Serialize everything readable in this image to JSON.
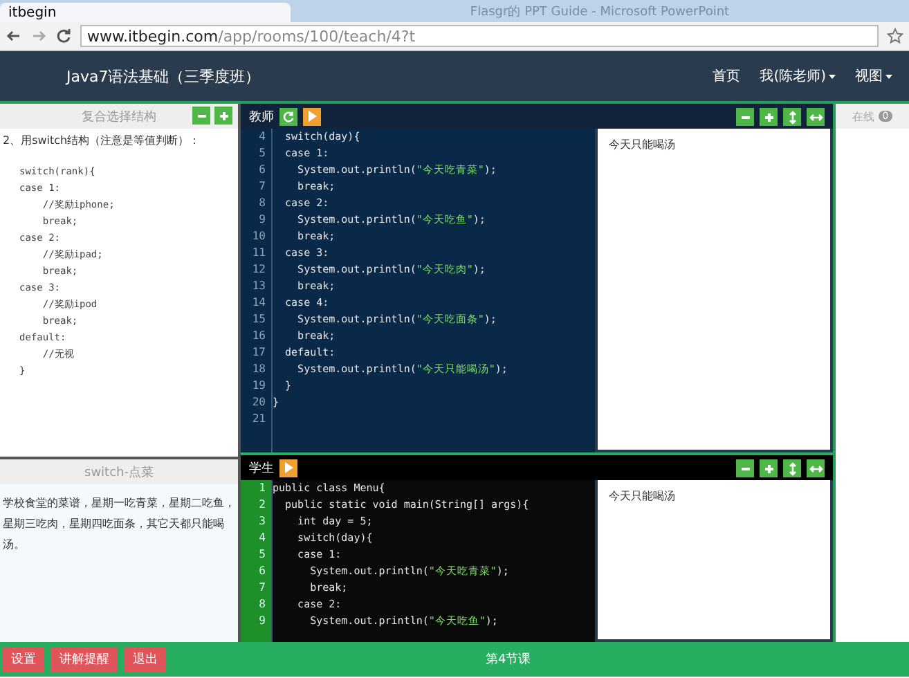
{
  "browser": {
    "tab_title": "itbegin",
    "url_host": "www.itbegin.com",
    "url_path": "/app/rooms/100/teach/4?t",
    "window_title": "Flasgr的 PPT Guide - Microsoft PowerPoint"
  },
  "header": {
    "title": "Java7语法基础（三季度班）",
    "nav": [
      {
        "label": "首页",
        "dropdown": false
      },
      {
        "label": "我(陈老师)",
        "dropdown": true
      },
      {
        "label": "视图",
        "dropdown": true
      }
    ]
  },
  "left_top": {
    "title": "复合选择结构",
    "intro": "2、用switch结构（注意是等值判断）：",
    "code": [
      "switch(rank){",
      "case 1:",
      "    //奖励iphone;",
      "    break;",
      "case 2:",
      "    //奖励ipad;",
      "    break;",
      "case 3:",
      "    //奖励ipod",
      "    break;",
      "default:",
      "    //无视",
      "}"
    ]
  },
  "left_bottom": {
    "title": "switch-点菜",
    "text": "学校食堂的菜谱，星期一吃青菜，星期二吃鱼，星期三吃肉，星期四吃面条，其它天都只能喝汤。"
  },
  "teacher": {
    "label": "教师",
    "code": [
      {
        "n": "4",
        "text": "  switch(day){"
      },
      {
        "n": "5",
        "text": "  case 1:"
      },
      {
        "n": "6",
        "text": "    System.out.println(\"今天吃青菜\");"
      },
      {
        "n": "7",
        "text": "    break;"
      },
      {
        "n": "8",
        "text": "  case 2:"
      },
      {
        "n": "9",
        "text": "    System.out.println(\"今天吃鱼\");"
      },
      {
        "n": "10",
        "text": "    break;"
      },
      {
        "n": "11",
        "text": "  case 3:"
      },
      {
        "n": "12",
        "text": "    System.out.println(\"今天吃肉\");"
      },
      {
        "n": "13",
        "text": "    break;"
      },
      {
        "n": "14",
        "text": "  case 4:"
      },
      {
        "n": "15",
        "text": "    System.out.println(\"今天吃面条\");"
      },
      {
        "n": "16",
        "text": "    break;"
      },
      {
        "n": "17",
        "text": "  default:"
      },
      {
        "n": "18",
        "text": "    System.out.println(\"今天只能喝汤\");"
      },
      {
        "n": "19",
        "text": "  }"
      },
      {
        "n": "20",
        "text": "}"
      },
      {
        "n": "21"
      }
    ],
    "output": "今天只能喝汤"
  },
  "student": {
    "label": "学生",
    "code": [
      {
        "n": "1",
        "text": "public class Menu{"
      },
      {
        "n": "2",
        "text": "  public static void main(String[] args){"
      },
      {
        "n": "3",
        "text": "    int day = 5;"
      },
      {
        "n": "4",
        "text": "    switch(day){"
      },
      {
        "n": "5",
        "text": "    case 1:"
      },
      {
        "n": "6",
        "text": "      System.out.println(\"今天吃青菜\");"
      },
      {
        "n": "7",
        "text": "      break;"
      },
      {
        "n": "8",
        "text": "    case 2:"
      },
      {
        "n": "9",
        "text": "      System.out.println(\"今天吃鱼\");"
      }
    ],
    "output": "今天只能喝汤"
  },
  "online": {
    "label": "在线",
    "count": "0"
  },
  "footer": {
    "buttons": [
      "设置",
      "讲解提醒",
      "退出"
    ],
    "status": "第4节课"
  }
}
